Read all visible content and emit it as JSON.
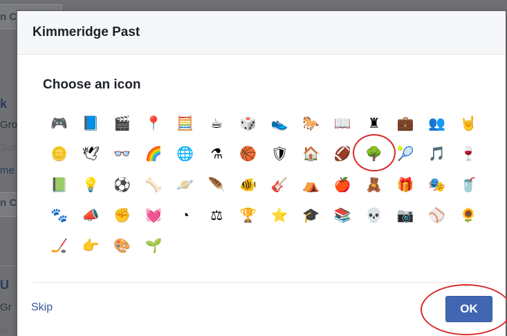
{
  "background": {
    "fragments": [
      "n C",
      "k",
      "Gro",
      "Sut",
      "me",
      "n C",
      "U",
      "Gr",
      "at"
    ]
  },
  "dialog": {
    "title": "Kimmeridge Past",
    "section_title": "Choose an icon",
    "icons": [
      {
        "name": "game-controller-icon",
        "glyph": "🎮"
      },
      {
        "name": "notebook-icon",
        "glyph": "📘"
      },
      {
        "name": "film-icon",
        "glyph": "🎬"
      },
      {
        "name": "pin-icon",
        "glyph": "📍"
      },
      {
        "name": "calculator-icon",
        "glyph": "🧮"
      },
      {
        "name": "coffee-mug-icon",
        "glyph": "☕"
      },
      {
        "name": "dice-icon",
        "glyph": "🎲"
      },
      {
        "name": "sneaker-icon",
        "glyph": "👟"
      },
      {
        "name": "horse-icon",
        "glyph": "🐎"
      },
      {
        "name": "book-icon",
        "glyph": "📖"
      },
      {
        "name": "chess-rook-icon",
        "glyph": "♜"
      },
      {
        "name": "briefcase-icon",
        "glyph": "💼"
      },
      {
        "name": "contacts-icon",
        "glyph": "👥"
      },
      {
        "name": "rock-hand-icon",
        "glyph": "🤘"
      },
      {
        "name": "coin-icon",
        "glyph": "🪙"
      },
      {
        "name": "dove-icon",
        "glyph": "🕊"
      },
      {
        "name": "glasses-icon",
        "glyph": "👓"
      },
      {
        "name": "rainbow-icon",
        "glyph": "🌈"
      },
      {
        "name": "globe-icon",
        "glyph": "🌐"
      },
      {
        "name": "flask-icon",
        "glyph": "⚗"
      },
      {
        "name": "basketball-icon",
        "glyph": "🏀"
      },
      {
        "name": "shield-icon",
        "glyph": "🛡"
      },
      {
        "name": "house-icon",
        "glyph": "🏠"
      },
      {
        "name": "football-icon",
        "glyph": "🏈"
      },
      {
        "name": "tree-icon",
        "glyph": "🌳"
      },
      {
        "name": "tennis-ball-icon",
        "glyph": "🎾"
      },
      {
        "name": "music-note-icon",
        "glyph": "🎵"
      },
      {
        "name": "wine-glass-icon",
        "glyph": "🍷"
      },
      {
        "name": "green-book-icon",
        "glyph": "📗"
      },
      {
        "name": "lightbulb-icon",
        "glyph": "💡"
      },
      {
        "name": "soccer-ball-icon",
        "glyph": "⚽"
      },
      {
        "name": "bone-icon",
        "glyph": "🦴"
      },
      {
        "name": "planet-icon",
        "glyph": "🪐"
      },
      {
        "name": "feather-icon",
        "glyph": "🪶"
      },
      {
        "name": "fishbowl-icon",
        "glyph": "🐠"
      },
      {
        "name": "guitar-icon",
        "glyph": "🎸"
      },
      {
        "name": "tent-icon",
        "glyph": "⛺"
      },
      {
        "name": "apple-icon",
        "glyph": "🍎"
      },
      {
        "name": "teddy-bear-icon",
        "glyph": "🧸"
      },
      {
        "name": "gift-icon",
        "glyph": "🎁"
      },
      {
        "name": "theater-masks-icon",
        "glyph": "🎭"
      },
      {
        "name": "red-cup-icon",
        "glyph": "🥤"
      },
      {
        "name": "paw-icon",
        "glyph": "🐾"
      },
      {
        "name": "megaphone-icon",
        "glyph": "📣"
      },
      {
        "name": "fist-icon",
        "glyph": "✊"
      },
      {
        "name": "heartbeat-icon",
        "glyph": "💓"
      },
      {
        "name": "pie-chart-icon",
        "glyph": "◔"
      },
      {
        "name": "gavel-icon",
        "glyph": "⚖"
      },
      {
        "name": "trophy-icon",
        "glyph": "🏆"
      },
      {
        "name": "star-badge-icon",
        "glyph": "⭐"
      },
      {
        "name": "graduation-cap-icon",
        "glyph": "🎓"
      },
      {
        "name": "bookshelf-icon",
        "glyph": "📚"
      },
      {
        "name": "skull-icon",
        "glyph": "💀"
      },
      {
        "name": "camera-icon",
        "glyph": "📷"
      },
      {
        "name": "baseball-icon",
        "glyph": "⚾"
      },
      {
        "name": "sunflower-icon",
        "glyph": "🌻"
      },
      {
        "name": "hockey-puck-icon",
        "glyph": "🏒"
      },
      {
        "name": "pointing-hand-icon",
        "glyph": "👉"
      },
      {
        "name": "palette-icon",
        "glyph": "🎨"
      },
      {
        "name": "plant-icon",
        "glyph": "🌱"
      }
    ],
    "highlighted_icon": "tree-icon",
    "skip_label": "Skip",
    "ok_label": "OK"
  },
  "colors": {
    "accent": "#4267b2",
    "link": "#365899",
    "annotation": "#d62828"
  }
}
